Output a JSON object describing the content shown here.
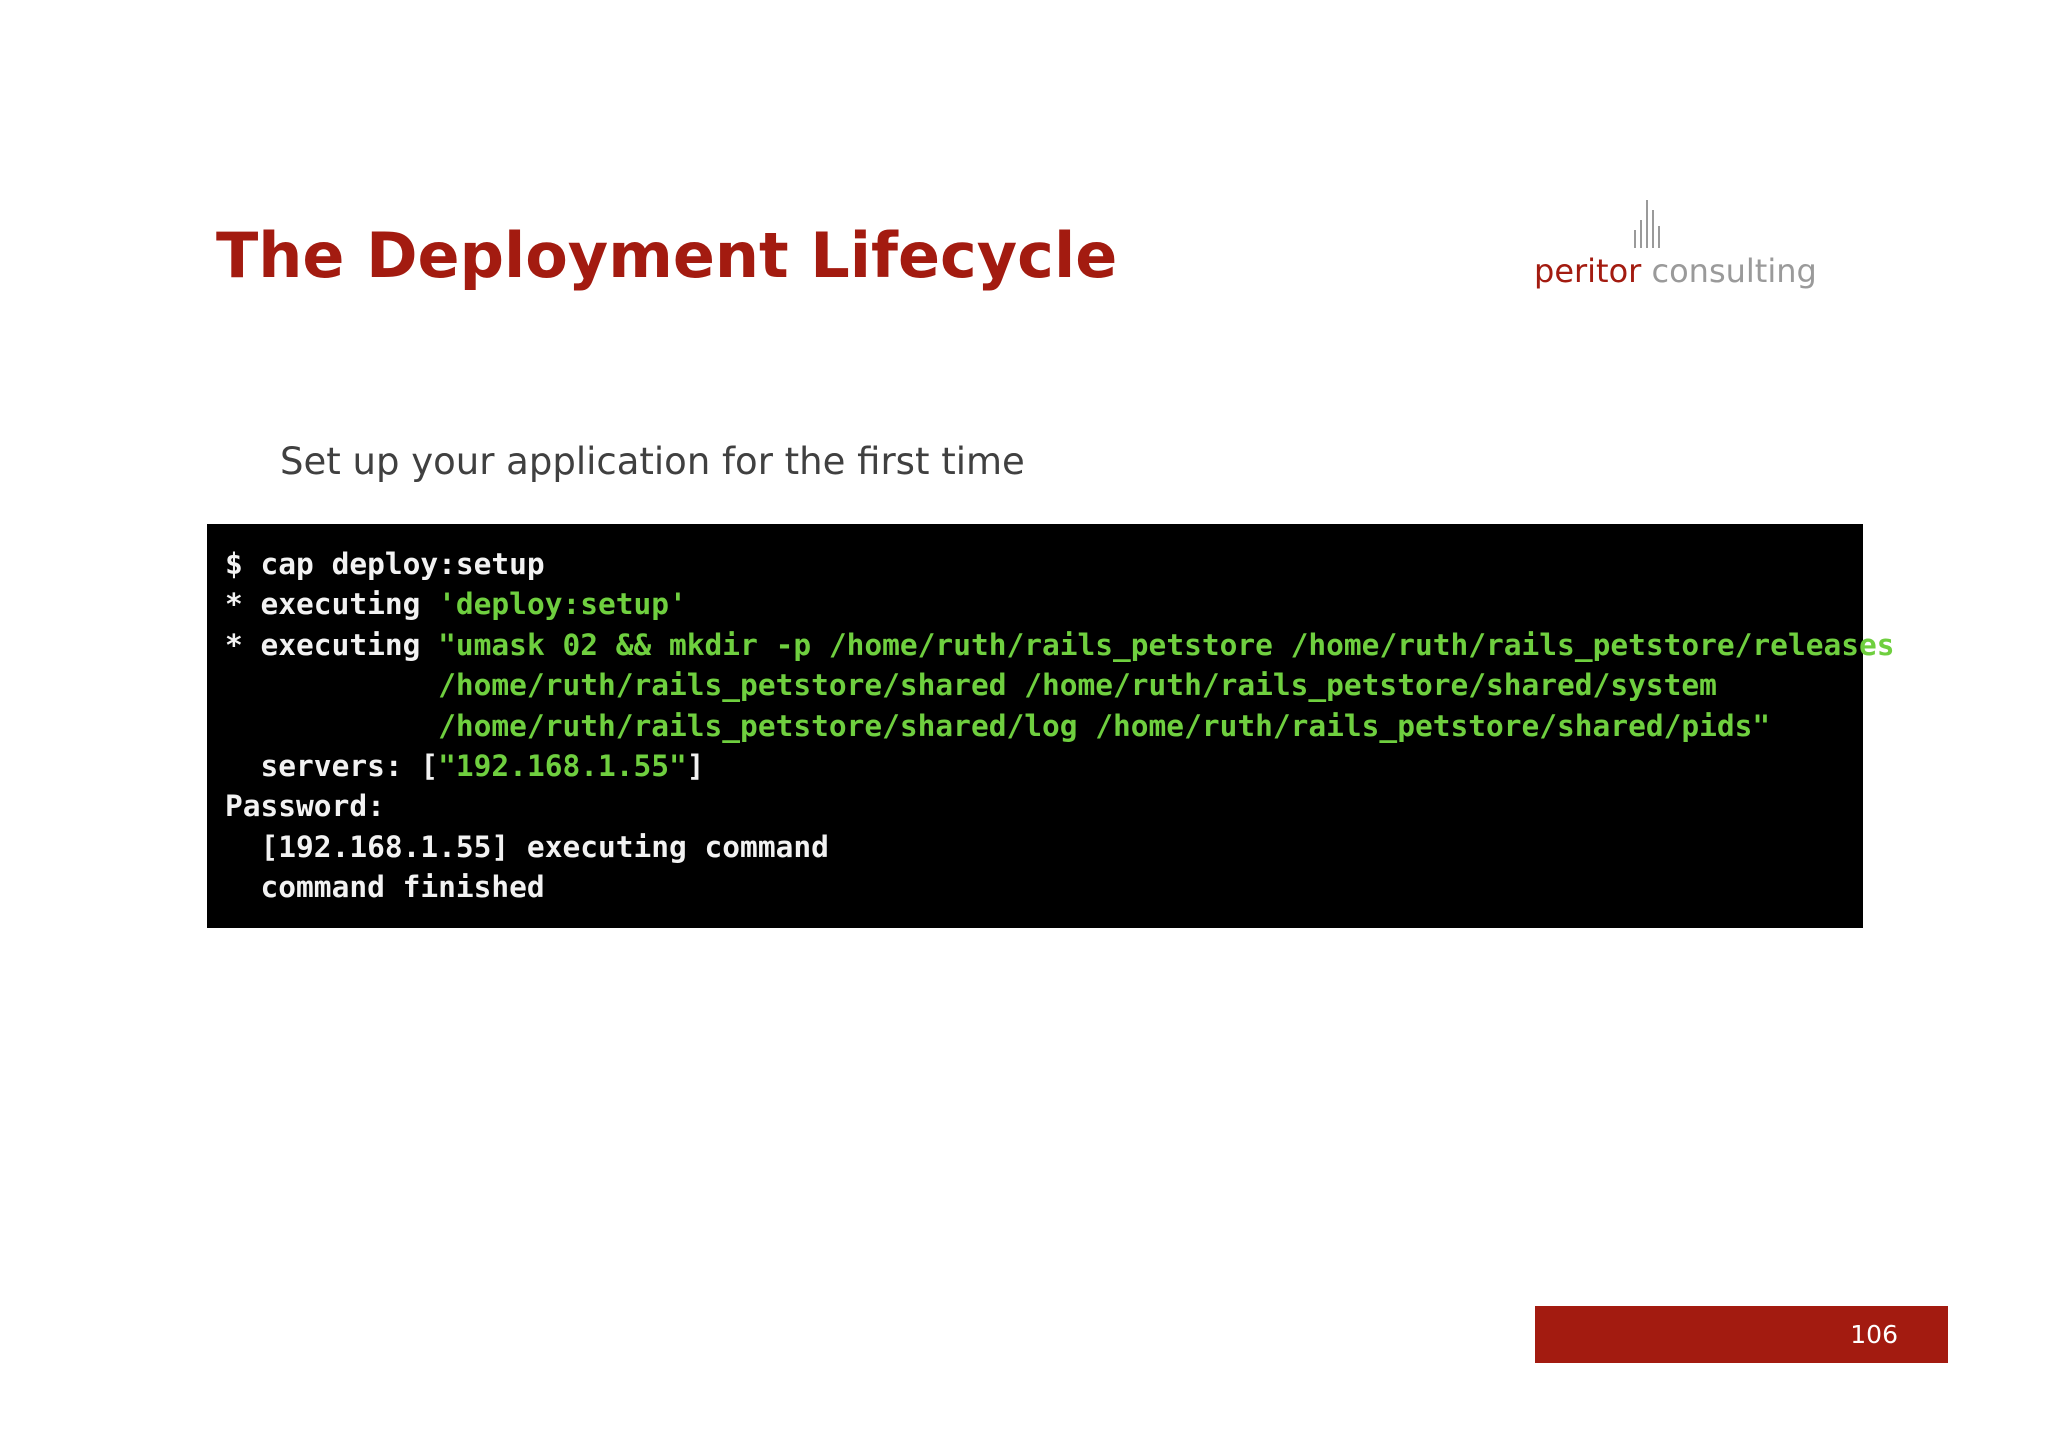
{
  "slide": {
    "title": "The Deployment Lifecycle",
    "subtitle": "Set up your application for the first time",
    "page_number": "106"
  },
  "logo": {
    "word1": "peritor",
    "word2": " consulting",
    "icon": "bar-lines-icon"
  },
  "terminal": {
    "lines": [
      [
        {
          "t": "$ cap deploy:setup",
          "c": "w"
        }
      ],
      [
        {
          "t": "* executing ",
          "c": "w"
        },
        {
          "t": "'deploy:setup'",
          "c": "g"
        }
      ],
      [
        {
          "t": "* executing ",
          "c": "w"
        },
        {
          "t": "\"umask 02 && mkdir -p /home/ruth/rails_petstore /home/ruth/rails_petstore/releases",
          "c": "g"
        }
      ],
      [
        {
          "t": "            /home/ruth/rails_petstore/shared /home/ruth/rails_petstore/shared/system",
          "c": "g"
        }
      ],
      [
        {
          "t": "            /home/ruth/rails_petstore/shared/log /home/ruth/rails_petstore/shared/pids\"",
          "c": "g"
        }
      ],
      [
        {
          "t": "  servers: [",
          "c": "w"
        },
        {
          "t": "\"192.168.1.55\"",
          "c": "g"
        },
        {
          "t": "]",
          "c": "w"
        }
      ],
      [
        {
          "t": "Password:",
          "c": "w"
        }
      ],
      [
        {
          "t": "  [192.168.1.55] executing command",
          "c": "w"
        }
      ],
      [
        {
          "t": "  command finished",
          "c": "w"
        }
      ]
    ]
  },
  "colors": {
    "accent": "#a31b10",
    "terminal_bg": "#000000",
    "terminal_text": "#f2f2f2",
    "terminal_green": "#6fcf3f"
  }
}
